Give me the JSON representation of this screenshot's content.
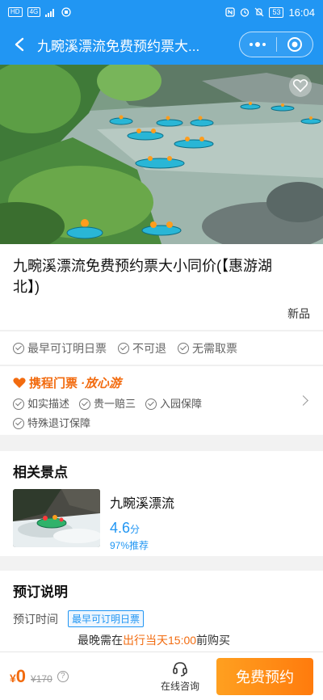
{
  "status_bar": {
    "left_tags": [
      "HD",
      "4G"
    ],
    "battery": "53",
    "time": "16:04"
  },
  "navbar": {
    "title": "九畹溪漂流免费预约票大..."
  },
  "product": {
    "title": "九畹溪漂流免费预约票大小同价(【惠游湖北】)",
    "new_tag": "新品"
  },
  "features": [
    {
      "label": "最早可订明日票",
      "icon": "check-circle-icon"
    },
    {
      "label": "不可退",
      "icon": "check-circle-icon"
    },
    {
      "label": "无需取票",
      "icon": "check-circle-icon"
    }
  ],
  "assurance": {
    "brand": "携程门票",
    "slogan": "·放心游",
    "items": [
      "如实描述",
      "贵一赔三",
      "入园保障",
      "特殊退订保障"
    ]
  },
  "related": {
    "section_title": "相关景点",
    "spot_name": "九畹溪漂流",
    "score": "4.6",
    "score_unit": "分",
    "recommend": "97%推荐"
  },
  "booking": {
    "section_title": "预订说明",
    "row_label": "预订时间",
    "badge": "最早可订明日票",
    "line_prefix": "最晚需在",
    "line_highlight": "出行当天15:00",
    "line_suffix": "前购买"
  },
  "bottom_bar": {
    "price_symbol": "¥",
    "price": "0",
    "original_price": "¥170",
    "help": "?",
    "consult_label": "在线咨询",
    "book_button": "免费预约"
  },
  "colors": {
    "primary": "#2196f3",
    "accent": "#f26b0f"
  }
}
